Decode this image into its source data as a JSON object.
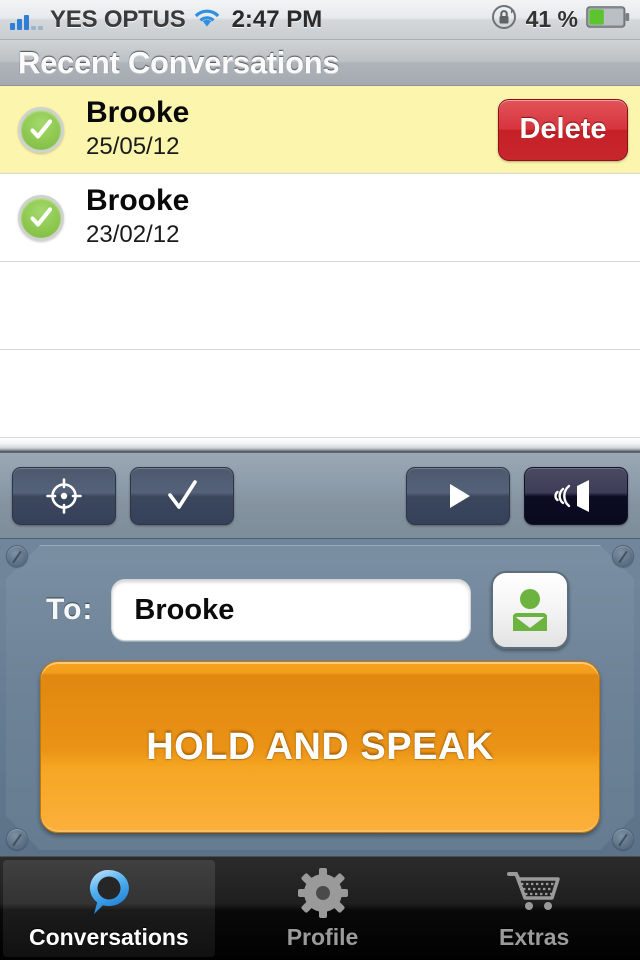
{
  "status_bar": {
    "carrier": "YES OPTUS",
    "signal_icon": "cellular-signal-icon",
    "signal_bars_filled": 3,
    "signal_bars_total": 5,
    "wifi_icon": "wifi-icon",
    "time": "2:47 PM",
    "rotation_lock_icon": "rotation-lock-icon",
    "battery_percent": "41 %",
    "battery_level": 41,
    "battery_icon": "battery-icon",
    "battery_color": "#5cc42e"
  },
  "nav": {
    "title": "Recent Conversations"
  },
  "list": {
    "rows": [
      {
        "name": "Brooke",
        "date": "25/05/12",
        "selected": true,
        "status_icon": "check-circle-icon",
        "delete_label": "Delete"
      },
      {
        "name": "Brooke",
        "date": "23/02/12",
        "selected": false,
        "status_icon": "check-circle-icon",
        "delete_label": ""
      }
    ],
    "empty_rows": 2,
    "selected_row_color": "#fbf5ad",
    "delete_button_color": "#c62027"
  },
  "toolbar": {
    "buttons": [
      {
        "icon": "crosshair-target-icon",
        "name": "locate-button",
        "active": false
      },
      {
        "icon": "checkmark-icon",
        "name": "select-button",
        "active": false
      },
      {
        "icon": "play-icon",
        "name": "play-button",
        "active": false
      },
      {
        "icon": "speaker-broadcast-icon",
        "name": "speaker-button",
        "active": true
      }
    ]
  },
  "compose": {
    "to_label": "To:",
    "to_value": "Brooke",
    "to_placeholder": "",
    "contact_icon": "contact-person-icon",
    "contact_icon_color": "#6cb33f",
    "speak_button_label": "HOLD AND SPEAK",
    "speak_button_color": "#f5a623"
  },
  "tab_bar": {
    "tabs": [
      {
        "label": "Conversations",
        "icon": "speech-bubble-icon",
        "active": true
      },
      {
        "label": "Profile",
        "icon": "gear-icon",
        "active": false
      },
      {
        "label": "Extras",
        "icon": "shopping-cart-icon",
        "active": false
      }
    ],
    "active_color": "#ffffff",
    "inactive_color": "#9b9b9b"
  }
}
